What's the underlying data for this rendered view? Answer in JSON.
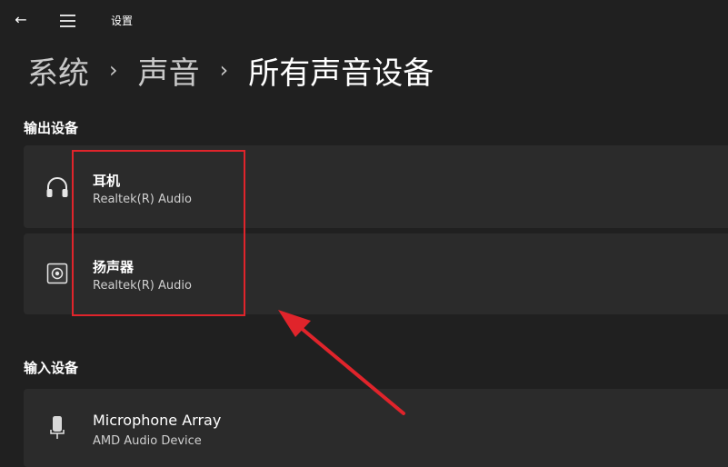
{
  "window": {
    "title": "设置"
  },
  "breadcrumb": {
    "items": [
      "系统",
      "声音",
      "所有声音设备"
    ],
    "separator": "›"
  },
  "output_section": {
    "title": "输出设备",
    "devices": [
      {
        "name": "耳机",
        "driver": "Realtek(R) Audio",
        "icon": "headphones-icon"
      },
      {
        "name": "扬声器",
        "driver": "Realtek(R) Audio",
        "icon": "speaker-icon"
      }
    ]
  },
  "input_section": {
    "title": "输入设备",
    "devices": [
      {
        "name": "Microphone Array",
        "driver": "AMD Audio Device",
        "icon": "microphone-icon"
      }
    ]
  },
  "colors": {
    "background": "#202020",
    "card": "#2b2b2b",
    "annotation": "#e0242b"
  }
}
